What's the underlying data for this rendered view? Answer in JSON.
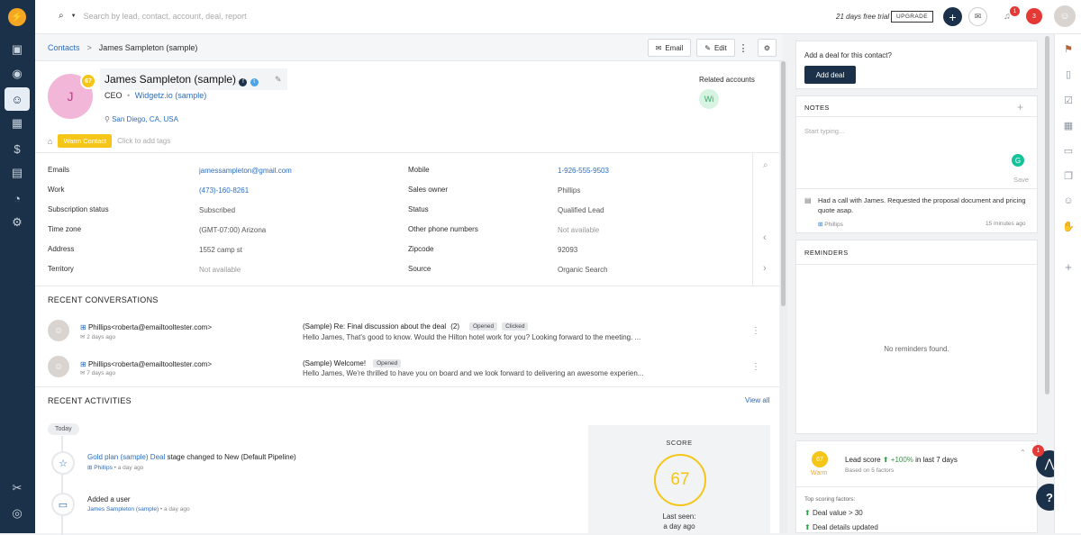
{
  "topbar": {
    "search_placeholder": "Search by lead, contact, account, deal, report",
    "trial_text": "21 days free trial",
    "upgrade_label": "UPGRADE",
    "notif_badge": "1",
    "alerts_badge": "3"
  },
  "sidebar": {
    "logo": "⚡",
    "items": [
      {
        "name": "calendar",
        "icon": "📅"
      },
      {
        "name": "contacts-circle",
        "icon": "◉"
      },
      {
        "name": "contacts",
        "icon": "👤"
      },
      {
        "name": "accounts",
        "icon": "▦"
      },
      {
        "name": "deals",
        "icon": "$"
      },
      {
        "name": "conversations",
        "icon": "💬"
      },
      {
        "name": "reports",
        "icon": "◔"
      },
      {
        "name": "settings",
        "icon": "⚙"
      },
      {
        "name": "tools",
        "icon": "✂"
      },
      {
        "name": "explore",
        "icon": "◎"
      }
    ]
  },
  "header": {
    "breadcrumb_link": "Contacts",
    "breadcrumb_sep": ">",
    "title": "James Sampleton (sample)",
    "email_btn": "Email",
    "edit_btn": "Edit"
  },
  "contact": {
    "initial": "J",
    "score": "67",
    "name": "James Sampleton (sample)",
    "job": "CEO",
    "company": "Widgetz.io (sample)",
    "location": "San Diego, CA, USA",
    "tag": "Warm Contact",
    "tag_hint": "Click to add tags",
    "related_label": "Related accounts",
    "related_initials": "Wi"
  },
  "fields_left": [
    {
      "label": "Emails",
      "value": "jamessampleton@gmail.com",
      "kind": "link"
    },
    {
      "label": "Work",
      "value": "(473)-160-8261",
      "kind": "link"
    },
    {
      "label": "Subscription status",
      "value": "Subscribed",
      "kind": "val"
    },
    {
      "label": "Time zone",
      "value": "(GMT-07:00) Arizona",
      "kind": "val"
    },
    {
      "label": "Address",
      "value": "1552 camp st",
      "kind": "val"
    },
    {
      "label": "Territory",
      "value": "Not available",
      "kind": "muted"
    }
  ],
  "fields_right": [
    {
      "label": "Mobile",
      "value": "1-926-555-9503",
      "kind": "link"
    },
    {
      "label": "Sales owner",
      "value": "Phillips",
      "kind": "val"
    },
    {
      "label": "Status",
      "value": "Qualified Lead",
      "kind": "val"
    },
    {
      "label": "Other phone numbers",
      "value": "Not available",
      "kind": "muted"
    },
    {
      "label": "Zipcode",
      "value": "92093",
      "kind": "val"
    },
    {
      "label": "Source",
      "value": "Organic Search",
      "kind": "val"
    }
  ],
  "conversations": {
    "title": "RECENT CONVERSATIONS",
    "items": [
      {
        "from": "Phillips<roberta@emailtooltester.com>",
        "time": "2 days ago",
        "subject": "(Sample) Re: Final discussion about the deal",
        "count": "(2)",
        "pills": [
          "Opened",
          "Clicked"
        ],
        "body": "Hello James, That's good to know. Would the Hilton hotel work for you? Looking forward to the meeting. ..."
      },
      {
        "from": "Phillips<roberta@emailtooltester.com>",
        "time": "7 days ago",
        "subject": "(Sample) Welcome!",
        "count": "",
        "pills": [
          "Opened"
        ],
        "body": "Hello James, We're thrilled to have you on board and we look forward to delivering an awesome experien..."
      }
    ]
  },
  "activities": {
    "title": "RECENT ACTIVITIES",
    "view_all": "View all",
    "today": "Today",
    "items": [
      {
        "link": "Gold plan (sample) Deal",
        "text": " stage changed to New (Default Pipeline)",
        "by": "Phillips",
        "time": "a day ago"
      },
      {
        "link": "",
        "text": "Added a user",
        "by": "James Sampleton (sample)",
        "time": "a day ago"
      }
    ],
    "score_title": "SCORE",
    "score_value": "67",
    "last_seen_label": "Last seen:",
    "last_seen_value": "a day ago"
  },
  "right": {
    "add_deal_prompt": "Add a deal for this contact?",
    "add_deal_btn": "Add deal",
    "notes_title": "NOTES",
    "notes_placeholder": "Start typing...",
    "save_label": "Save",
    "note_text": "Had a call with James. Requested the proposal document and pricing quote asap.",
    "note_author": "Phillips",
    "note_time": "15 minutes ago",
    "reminders_title": "REMINDERS",
    "reminders_empty": "No reminders found.",
    "lead_score_value": "67",
    "lead_score_level": "Warm",
    "lead_score_label": "Lead score",
    "lead_score_change": "+100%",
    "lead_score_period": "in last 7 days",
    "lead_score_basis": "Based on 5 factors",
    "factors_title": "Top scoring factors:",
    "factors": [
      "Deal value > 30",
      "Deal details updated"
    ],
    "fab_badge": "1",
    "help_label": "?"
  },
  "colors": {
    "sidebar": "#1b3149",
    "accent": "#2c6dbf",
    "warm": "#f5c518",
    "danger": "#e53935"
  }
}
